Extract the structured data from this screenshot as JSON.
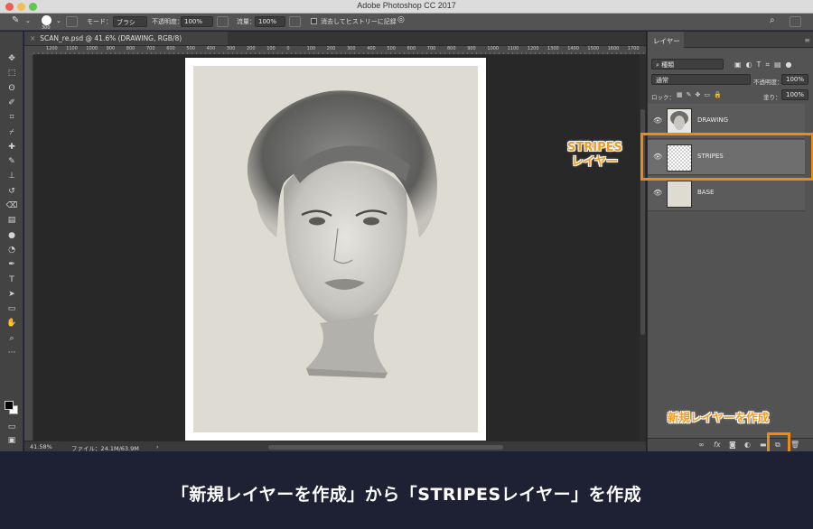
{
  "window": {
    "title": "Adobe Photoshop CC 2017"
  },
  "options_bar": {
    "brush_size": "300",
    "mode_label": "モード：",
    "mode_value": "ブラシ",
    "opacity_label": "不透明度：",
    "opacity_value": "100%",
    "flow_label": "流量：",
    "flow_value": "100%",
    "history_label": "消去してヒストリーに記録"
  },
  "tools": [
    "move-icon",
    "marquee-icon",
    "lasso-icon",
    "quick-select-icon",
    "crop-icon",
    "eyedropper-icon",
    "healing-icon",
    "brush-icon",
    "stamp-icon",
    "history-brush-icon",
    "eraser-icon",
    "gradient-icon",
    "blur-icon",
    "dodge-icon",
    "pen-icon",
    "type-icon",
    "path-select-icon",
    "shape-icon",
    "hand-icon",
    "zoom-icon",
    "more-icon"
  ],
  "document": {
    "tab_title": "SCAN_re.psd @ 41.6% (DRAWING, RGB/8)",
    "ruler_ticks": [
      "1200",
      "1100",
      "1000",
      "900",
      "800",
      "700",
      "600",
      "500",
      "400",
      "300",
      "200",
      "100",
      "0",
      "100",
      "200",
      "300",
      "400",
      "500",
      "600",
      "700",
      "800",
      "900",
      "1000",
      "1100",
      "1200",
      "1300",
      "1400",
      "1500",
      "1600",
      "1700"
    ]
  },
  "status_bar": {
    "zoom": "41.58%",
    "file_info": "ファイル：24.1M/63.9M"
  },
  "layers_panel": {
    "tab_label": "レイヤー",
    "filter_label": "種類",
    "blend_mode": "通常",
    "opacity_label": "不透明度：",
    "opacity_value": "100%",
    "lock_label": "ロック：",
    "fill_label": "塗り：",
    "fill_value": "100%",
    "layers": [
      {
        "name": "DRAWING",
        "selected": false
      },
      {
        "name": "STRIPES",
        "selected": true
      },
      {
        "name": "BASE",
        "selected": false
      }
    ]
  },
  "annotations": {
    "stripes_callout_line1": "STRIPES",
    "stripes_callout_line2": "レイヤー",
    "new_layer_callout": "新規レイヤーを作成",
    "accent_color": "#f39a1e"
  },
  "caption": "「新規レイヤーを作成」から「STRIPESレイヤー」を作成"
}
